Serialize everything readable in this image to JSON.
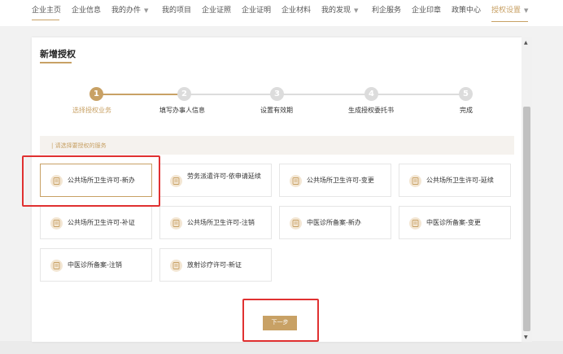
{
  "nav": {
    "items": [
      {
        "label": "企业主页"
      },
      {
        "label": "企业信息"
      },
      {
        "label": "我的办件"
      },
      {
        "label": "我的项目"
      },
      {
        "label": "企业证照"
      },
      {
        "label": "企业证明"
      },
      {
        "label": "企业材料"
      },
      {
        "label": "我的发现"
      },
      {
        "label": "利企服务"
      },
      {
        "label": "企业印章"
      },
      {
        "label": "政策中心"
      },
      {
        "label": "授权设置"
      }
    ],
    "active": "授权设置"
  },
  "card": {
    "title": "新增授权"
  },
  "steps": [
    {
      "num": "1",
      "label": "选择授权业务",
      "state": "active"
    },
    {
      "num": "2",
      "label": "填写办事人信息",
      "state": "pending"
    },
    {
      "num": "3",
      "label": "设置有效期",
      "state": "pending"
    },
    {
      "num": "4",
      "label": "生成授权委托书",
      "state": "pending"
    },
    {
      "num": "5",
      "label": "完成",
      "state": "pending"
    }
  ],
  "section": {
    "hint": "| 请选择要授权的服务"
  },
  "services": [
    {
      "label": "公共场所卫生许可-新办",
      "selected": true
    },
    {
      "label": "劳务派遣许可-依申请延续",
      "selected": false
    },
    {
      "label": "公共场所卫生许可-变更",
      "selected": false
    },
    {
      "label": "公共场所卫生许可-延续",
      "selected": false
    },
    {
      "label": "公共场所卫生许可-补证",
      "selected": false
    },
    {
      "label": "公共场所卫生许可-注销",
      "selected": false
    },
    {
      "label": "中医诊所备案-新办",
      "selected": false
    },
    {
      "label": "中医诊所备案-变更",
      "selected": false
    },
    {
      "label": "中医诊所备案-注销",
      "selected": false
    },
    {
      "label": "放射诊疗许可-新证",
      "selected": false
    }
  ],
  "actions": {
    "next_label": "下一步"
  },
  "colors": {
    "accent": "#c8a165",
    "step_inactive": "#dcdcdc",
    "highlight": "#e03131"
  }
}
